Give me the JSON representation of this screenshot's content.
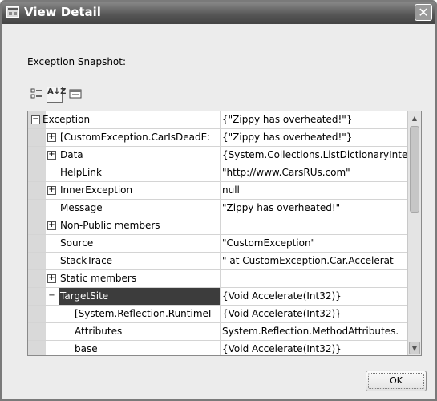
{
  "window": {
    "title": "View Detail",
    "close_label": "✕"
  },
  "snapshot_label": "Exception Snapshot:",
  "toolbar": {
    "alpha_label": "A↓Z"
  },
  "grid": {
    "rows": [
      {
        "name": "Exception",
        "value": "{\"Zippy has overheated!\"}",
        "level": 0,
        "expander": "−"
      },
      {
        "name": "[CustomException.CarIsDeadE:",
        "value": "{\"Zippy has overheated!\"}",
        "level": 1,
        "expander": "+"
      },
      {
        "name": "Data",
        "value": "{System.Collections.ListDictionaryInte",
        "level": 1,
        "expander": "+"
      },
      {
        "name": "HelpLink",
        "value": "\"http://www.CarsRUs.com\"",
        "level": 1,
        "expander": ""
      },
      {
        "name": "InnerException",
        "value": "null",
        "level": 1,
        "expander": "+"
      },
      {
        "name": "Message",
        "value": "\"Zippy has overheated!\"",
        "level": 1,
        "expander": ""
      },
      {
        "name": "Non-Public members",
        "value": "",
        "level": 1,
        "expander": "+"
      },
      {
        "name": "Source",
        "value": "\"CustomException\"",
        "level": 1,
        "expander": ""
      },
      {
        "name": "StackTrace",
        "value": "\"   at CustomException.Car.Accelerat",
        "level": 1,
        "expander": ""
      },
      {
        "name": "Static members",
        "value": "",
        "level": 1,
        "expander": "+"
      },
      {
        "name": "TargetSite",
        "value": "{Void Accelerate(Int32)}",
        "level": 1,
        "expander": "−",
        "selected": true
      },
      {
        "name": "[System.Reflection.RuntimeI",
        "value": "{Void Accelerate(Int32)}",
        "level": 2,
        "expander": ""
      },
      {
        "name": "Attributes",
        "value": "System.Reflection.MethodAttributes.",
        "level": 2,
        "expander": ""
      },
      {
        "name": "base",
        "value": "{Void Accelerate(Int32)}",
        "level": 2,
        "expander": ""
      }
    ]
  },
  "ok_label": "OK"
}
